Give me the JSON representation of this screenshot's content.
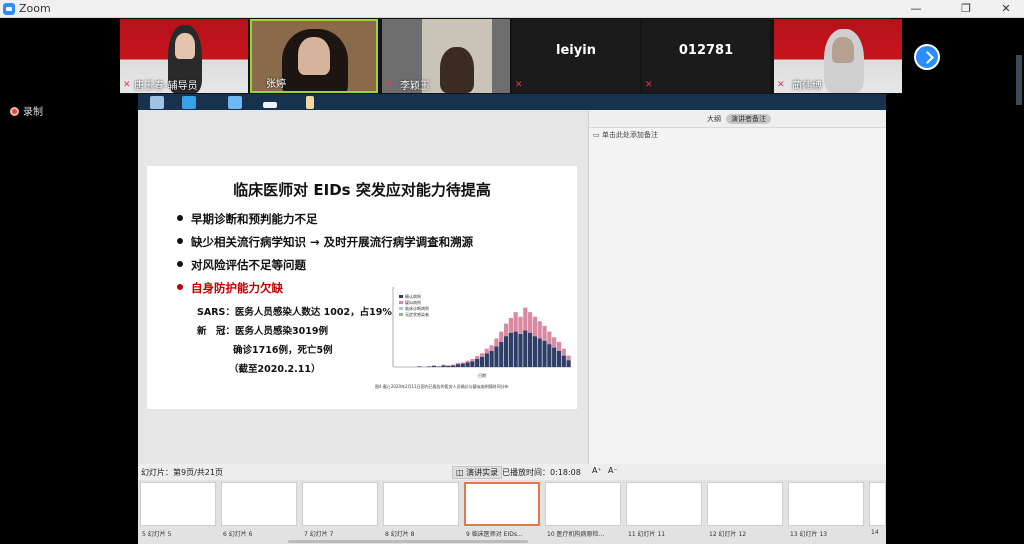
{
  "window": {
    "title": "Zoom"
  },
  "participants": [
    {
      "name": "唐玉春-辅导员"
    },
    {
      "name": "张婷"
    },
    {
      "name": "李颖玉"
    },
    {
      "name": "leiyin"
    },
    {
      "name": "012781"
    },
    {
      "name": "蔺伟博"
    }
  ],
  "recording": {
    "label": "录制"
  },
  "notes": {
    "tab_outline": "大纲",
    "tab_presenter": "演讲者备注",
    "placeholder": "单击此处添加备注"
  },
  "slide": {
    "title": "临床医师对 EIDs 突发应对能力待提高",
    "bullets": [
      "早期诊断和预判能力不足",
      "缺少相关流行病学知识 → 及时开展流行病学调查和溯源",
      "对风险评估不足等问题",
      "自身防护能力欠缺"
    ],
    "sars_line": "SARS：医务人员感染人数达 1002，占19%",
    "new_line": "新　冠：医务人员感染3019例",
    "confirmed_line": "确诊1716例，死亡5例",
    "date_line": "（截至2020.2.11）",
    "chart_caption": "图4  截止2020年2月11日国内已报告的医务人员确诊与疑似病例随时间分布",
    "chart_legend": [
      "确认病例",
      "疑似病例",
      "临床诊断病例",
      "无症状感染者"
    ],
    "chart_xlabel": "日期"
  },
  "status": {
    "slide_counter": "幻灯片：第9页/共21页",
    "presenter_view": "演讲实录",
    "elapsed_label": "已播放时间：0:18:08",
    "font_up": "A⁺",
    "font_down": "A⁻"
  },
  "thumbnails": [
    {
      "label": "5  幻灯片 5"
    },
    {
      "label": "6  幻灯片 6"
    },
    {
      "label": "7  幻灯片 7"
    },
    {
      "label": "8  幻灯片 8"
    },
    {
      "label": "9  临床医师对 EIDs..."
    },
    {
      "label": "10 医疗机构病原检..."
    },
    {
      "label": "11 幻灯片 11"
    },
    {
      "label": "12 幻灯片 12"
    },
    {
      "label": "13 幻灯片 13"
    },
    {
      "label": "14"
    }
  ],
  "chart_data": {
    "type": "bar",
    "stacked": true,
    "xlabel": "日期",
    "ylabel": "",
    "series": [
      {
        "name": "确认病例",
        "color": "#2f3e66",
        "values": [
          0,
          0,
          0,
          0,
          0,
          1,
          0,
          1,
          2,
          1,
          3,
          2,
          3,
          5,
          6,
          8,
          10,
          14,
          18,
          24,
          28,
          36,
          44,
          54,
          60,
          62,
          58,
          64,
          60,
          54,
          50,
          46,
          40,
          34,
          28,
          20,
          12
        ]
      },
      {
        "name": "疑似病例",
        "color": "#d98aa0",
        "values": [
          0,
          0,
          0,
          0,
          0,
          0,
          0,
          0,
          1,
          0,
          1,
          1,
          1,
          2,
          2,
          3,
          4,
          5,
          6,
          8,
          10,
          14,
          18,
          22,
          26,
          34,
          30,
          40,
          36,
          34,
          30,
          26,
          22,
          18,
          16,
          12,
          8
        ]
      }
    ],
    "ylim": [
      0,
      140
    ]
  }
}
